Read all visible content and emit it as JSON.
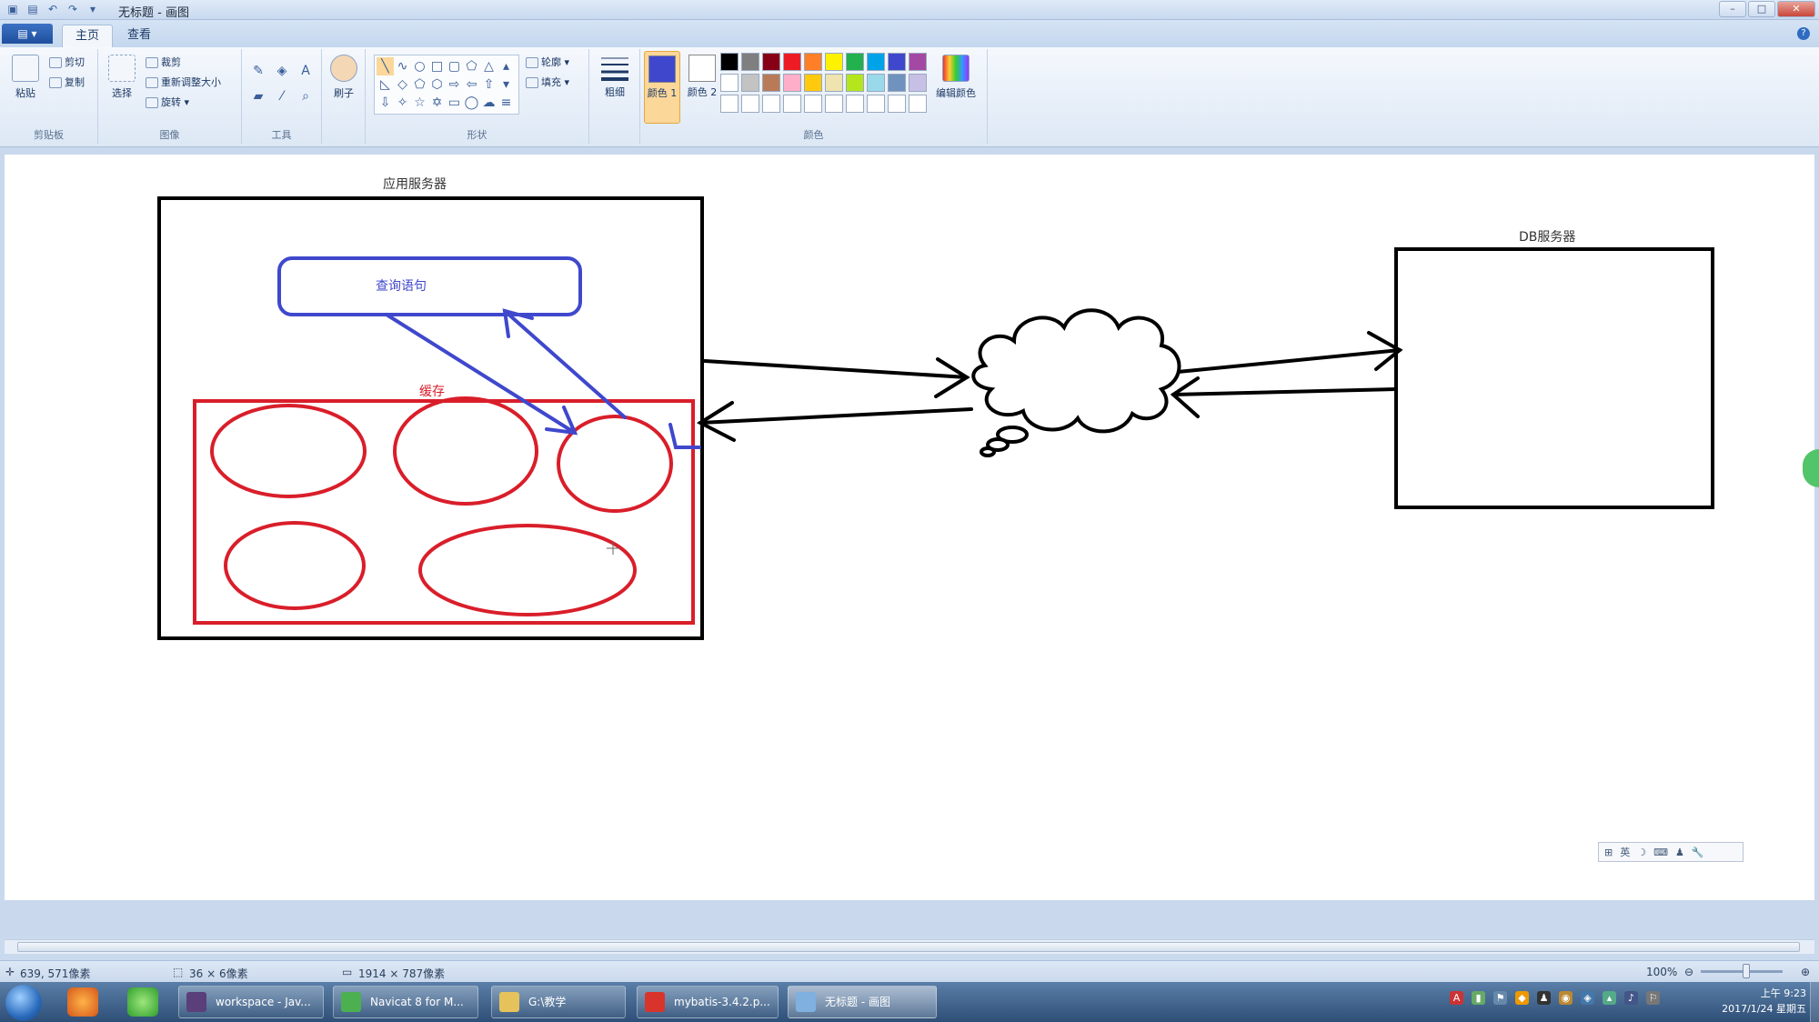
{
  "window": {
    "title": "无标题 - 画图",
    "quick_access_icons": [
      "save-icon",
      "undo-icon",
      "redo-icon",
      "customize-icon"
    ]
  },
  "tabs": {
    "file_label": "▤ ▾",
    "items": [
      "主页",
      "查看"
    ]
  },
  "ribbon": {
    "clipboard": {
      "label": "剪贴板",
      "paste": "粘贴",
      "cut": "剪切",
      "copy": "复制"
    },
    "image": {
      "label": "图像",
      "select": "选择",
      "crop": "裁剪",
      "resize": "重新调整大小",
      "rotate": "旋转"
    },
    "tools": {
      "label": "工具"
    },
    "brushes": {
      "label": "刷子"
    },
    "shapes": {
      "label": "形状",
      "outline": "轮廓",
      "fill": "填充"
    },
    "size": {
      "label": "粗细"
    },
    "colors": {
      "label": "颜色",
      "color1_label": "颜色 1",
      "color2_label": "颜色 2",
      "edit_colors": "编辑颜色",
      "color1": "#3f48cc",
      "color2": "#ffffff",
      "palette": [
        "#000000",
        "#7f7f7f",
        "#880015",
        "#ed1c24",
        "#ff7f27",
        "#fff200",
        "#22b14c",
        "#00a2e8",
        "#3f48cc",
        "#a349a4",
        "#ffffff",
        "#c3c3c3",
        "#b97a57",
        "#ffaec9",
        "#ffc90e",
        "#efe4b0",
        "#b5e61d",
        "#99d9ea",
        "#7092be",
        "#c8bfe7",
        "#ffffff",
        "#ffffff",
        "#ffffff",
        "#ffffff",
        "#ffffff",
        "#ffffff",
        "#ffffff",
        "#ffffff",
        "#ffffff",
        "#ffffff"
      ]
    }
  },
  "canvas": {
    "app_server_label": "应用服务器",
    "query_label": "查询语句",
    "cache_label": "缓存",
    "db_server_label": "DB服务器",
    "colors": {
      "black": "#000000",
      "blue": "#3f48cc",
      "red": "#d91e2a"
    }
  },
  "ime_bar": {
    "items": [
      "英",
      "☽",
      "⌨",
      "♟",
      "🔧"
    ]
  },
  "statusbar": {
    "cursor_pos": "639, 571像素",
    "selection_size": "36 × 6像素",
    "image_size": "1914 × 787像素",
    "zoom": "100%"
  },
  "taskbar": {
    "tasks": [
      {
        "label": "workspace - Jav...",
        "color": "#5a3f7a"
      },
      {
        "label": "Navicat 8 for M...",
        "color": "#4caf50"
      },
      {
        "label": "G:\\教学",
        "color": "#e5c35a"
      },
      {
        "label": "mybatis-3.4.2.p...",
        "color": "#d9342b"
      },
      {
        "label": "无标题 - 画图",
        "color": "#7fb0e0"
      }
    ],
    "clock_time": "上午 9:23",
    "clock_date": "2017/1/24 星期五"
  }
}
